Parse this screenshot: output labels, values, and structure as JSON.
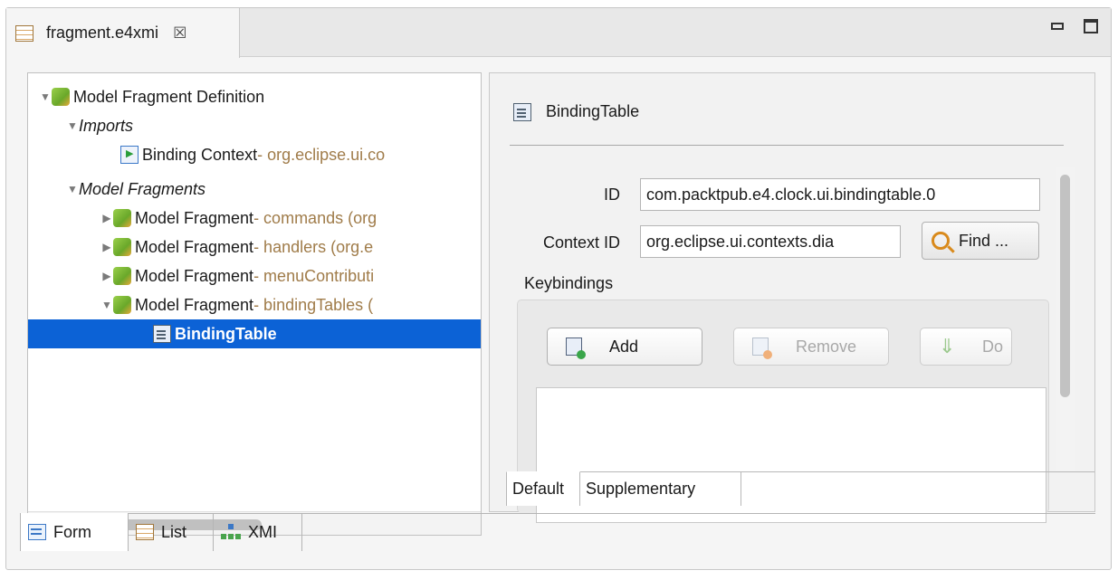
{
  "editor_tab": {
    "title": "fragment.e4xmi",
    "close_glyph": "☒",
    "icon": "editor-grid-icon"
  },
  "window_controls": {
    "minimize_icon": "minimize-icon",
    "maximize_icon": "maximize-icon"
  },
  "tree": {
    "items": [
      {
        "label": "Model Fragment Definition",
        "decoration": "",
        "expanded": true,
        "icon": "puzzle-icon"
      },
      {
        "label": "Imports",
        "decoration": "",
        "expanded": true,
        "icon": ""
      },
      {
        "label": "Binding Context",
        "decoration": " - org.eclipse.ui.co",
        "expanded": null,
        "icon": "binding-context-icon"
      },
      {
        "label": "Model Fragments",
        "decoration": "",
        "expanded": true,
        "icon": ""
      },
      {
        "label": "Model Fragment",
        "decoration": " - commands (org",
        "expanded": false,
        "icon": "puzzle-icon"
      },
      {
        "label": "Model Fragment",
        "decoration": " - handlers (org.e",
        "expanded": false,
        "icon": "puzzle-icon"
      },
      {
        "label": "Model Fragment",
        "decoration": " - menuContributi",
        "expanded": false,
        "icon": "puzzle-icon"
      },
      {
        "label": "Model Fragment",
        "decoration": " - bindingTables (",
        "expanded": true,
        "icon": "puzzle-icon"
      },
      {
        "label": "BindingTable",
        "decoration": "",
        "expanded": null,
        "icon": "binding-table-icon",
        "selected": true
      }
    ]
  },
  "detail": {
    "title": "BindingTable",
    "id_label": "ID",
    "id_value": "com.packtpub.e4.clock.ui.bindingtable.0",
    "context_label": "Context ID",
    "context_value": "org.eclipse.ui.contexts.dia",
    "find_label": "Find ...",
    "keybindings_label": "Keybindings",
    "add_label": "Add",
    "remove_label": "Remove",
    "down_label": "Do",
    "tabs": [
      "Default",
      "Supplementary"
    ]
  },
  "bottom_tabs": [
    "Form",
    "List",
    "XMI"
  ],
  "colors": {
    "selection": "#0c62d6",
    "decoration": "#a07c4a"
  }
}
